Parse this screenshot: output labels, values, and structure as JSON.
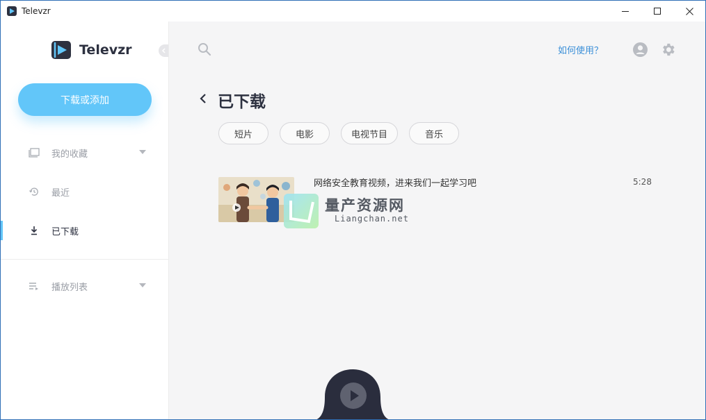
{
  "window": {
    "title": "Televzr",
    "controls": [
      "minimize-icon",
      "maximize-icon",
      "close-icon"
    ]
  },
  "sidebar": {
    "brand_name": "Televzr",
    "add_button_label": "下载或添加",
    "items": [
      {
        "label": "我的收藏",
        "icon": "folder-icon",
        "has_caret": true,
        "active": false
      },
      {
        "label": "最近",
        "icon": "history-icon",
        "has_caret": false,
        "active": false
      },
      {
        "label": "已下载",
        "icon": "download-icon",
        "has_caret": false,
        "active": true
      },
      {
        "label": "播放列表",
        "icon": "playlist-icon",
        "has_caret": true,
        "active": false
      }
    ]
  },
  "header": {
    "help_link": "如何使用？"
  },
  "main": {
    "page_title": "已下载",
    "filters": [
      "短片",
      "电影",
      "电视节目",
      "音乐"
    ],
    "videos": [
      {
        "title": "网络安全教育视频，进来我们一起学习吧",
        "duration": "5:28"
      }
    ]
  },
  "watermark": {
    "text": "量产资源网",
    "subtext": "Liangchan.net"
  },
  "colors": {
    "accent": "#62c6f9",
    "link": "#3a8fd8",
    "title_text": "#2d3140",
    "player_dock": "#2a2d3d"
  }
}
